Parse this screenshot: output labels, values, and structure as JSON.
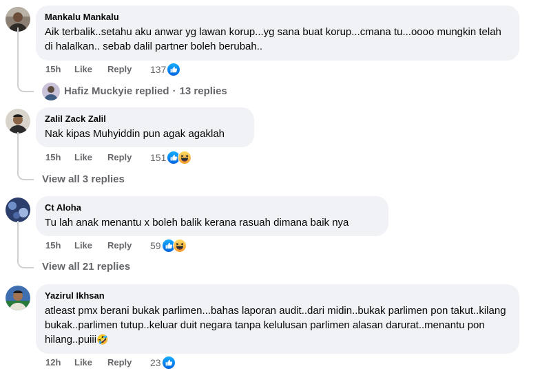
{
  "comments": [
    {
      "author": "Mankalu Mankalu",
      "text": "Aik terbalik..setahu aku anwar yg lawan korup...yg sana buat korup...cmana tu...oooo mungkin telah di halalkan.. sebab dalil partner boleh berubah..",
      "time": "15h",
      "like_label": "Like",
      "reply_label": "Reply",
      "reaction_count": "137",
      "reactions": [
        "like-reaction-icon"
      ],
      "replies": {
        "replier": "Hafiz Muckyie replied",
        "separator": "·",
        "count_text": "13 replies"
      }
    },
    {
      "author": "Zalil Zack Zalil",
      "text": "Nak kipas Muhyiddin pun agak agaklah",
      "time": "15h",
      "like_label": "Like",
      "reply_label": "Reply",
      "reaction_count": "151",
      "reactions": [
        "like-reaction-icon",
        "haha-reaction-icon"
      ],
      "replies": {
        "text": "View all 3 replies"
      }
    },
    {
      "author": "Ct Aloha",
      "text": "Tu lah anak menantu x boleh balik kerana rasuah dimana baik nya",
      "time": "15h",
      "like_label": "Like",
      "reply_label": "Reply",
      "reaction_count": "59",
      "reactions": [
        "like-reaction-icon",
        "haha-reaction-icon"
      ],
      "replies": {
        "text": "View all 21 replies"
      }
    },
    {
      "author": "Yazirul Ikhsan",
      "text": "atleast pmx berani bukak parlimen...bahas laporan audit..dari midin..bukak parlimen pon takut..kilang bukak..parlimen tutup..keluar duit negara tanpa kelulusan parlimen alasan darurat..menantu pon hilang..puiii",
      "text_emoji": "🤣",
      "time": "12h",
      "like_label": "Like",
      "reply_label": "Reply",
      "reaction_count": "23",
      "reactions": [
        "like-reaction-icon"
      ]
    }
  ],
  "colors": {
    "bubble": "#f0f2f5",
    "meta_text": "#65676b",
    "like_blue": "#1877f2",
    "haha_yellow": "#f7b125"
  }
}
